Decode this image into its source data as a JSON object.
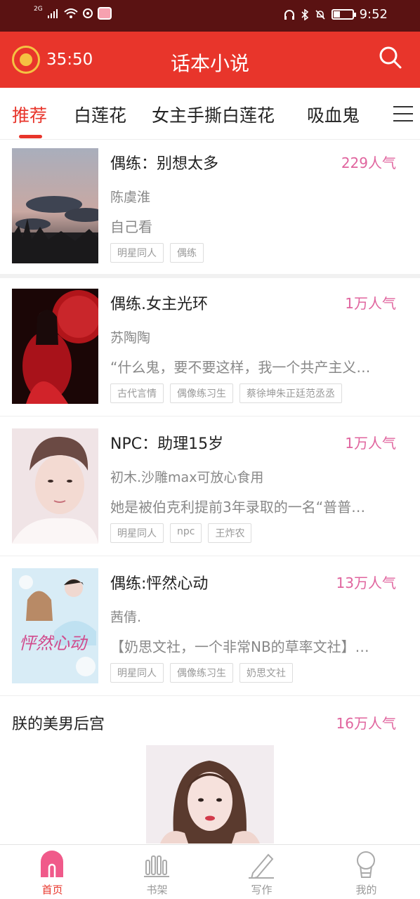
{
  "status": {
    "network": "2G",
    "time": "9:52"
  },
  "header": {
    "timer": "35:50",
    "title": "话本小说",
    "icons": {
      "timer": "alarm-clock-icon",
      "search": "search-icon"
    }
  },
  "tabs": [
    {
      "label": "推荐",
      "active": true
    },
    {
      "label": "白莲花"
    },
    {
      "label": "女主手撕白莲花"
    },
    {
      "label": "吸血鬼"
    }
  ],
  "books": [
    {
      "title": "偶练：别想太多",
      "popularity": "229人气",
      "author": "陈虞淮",
      "desc": "自己看",
      "tags": [
        "明星同人",
        "偶练"
      ],
      "cover": "dusk-sky-photo"
    },
    {
      "title": "偶练.女主光环",
      "popularity": "1万人气",
      "author": "苏陶陶",
      "desc": "“什么鬼，要不要这样，我一个共产主义…",
      "tags": [
        "古代言情",
        "偶像练习生",
        "蔡徐坤朱正廷范丞丞"
      ],
      "cover": "woman-red-umbrella"
    },
    {
      "title": "NPC：助理15岁",
      "popularity": "1万人气",
      "author": "初木.沙雕max可放心食用",
      "desc": "她是被伯克利提前3年录取的一名“普普…",
      "tags": [
        "明星同人",
        "npc",
        "王炸农"
      ],
      "cover": "young-man-portrait"
    },
    {
      "title": "偶练:怦然心动",
      "popularity": "13万人气",
      "author": "茜倩.",
      "desc": "【奶思文社，一个非常NB的草率文社】…",
      "tags": [
        "明星同人",
        "偶像练习生",
        "奶思文社"
      ],
      "cover": "illustrated-cover-pengran-xindong",
      "cover_text": "怦然心动"
    }
  ],
  "featured": {
    "title": "朕的美男后宫",
    "popularity": "16万人气",
    "cover": "girl-portrait"
  },
  "bottom_nav": [
    {
      "label": "首页",
      "icon": "home-icon",
      "active": true
    },
    {
      "label": "书架",
      "icon": "bookshelf-icon"
    },
    {
      "label": "写作",
      "icon": "pen-icon"
    },
    {
      "label": "我的",
      "icon": "profile-icon"
    }
  ],
  "colors": {
    "status_bar": "#5a1212",
    "header": "#e8352b",
    "accent": "#e8352b",
    "popularity": "#e0649e"
  }
}
